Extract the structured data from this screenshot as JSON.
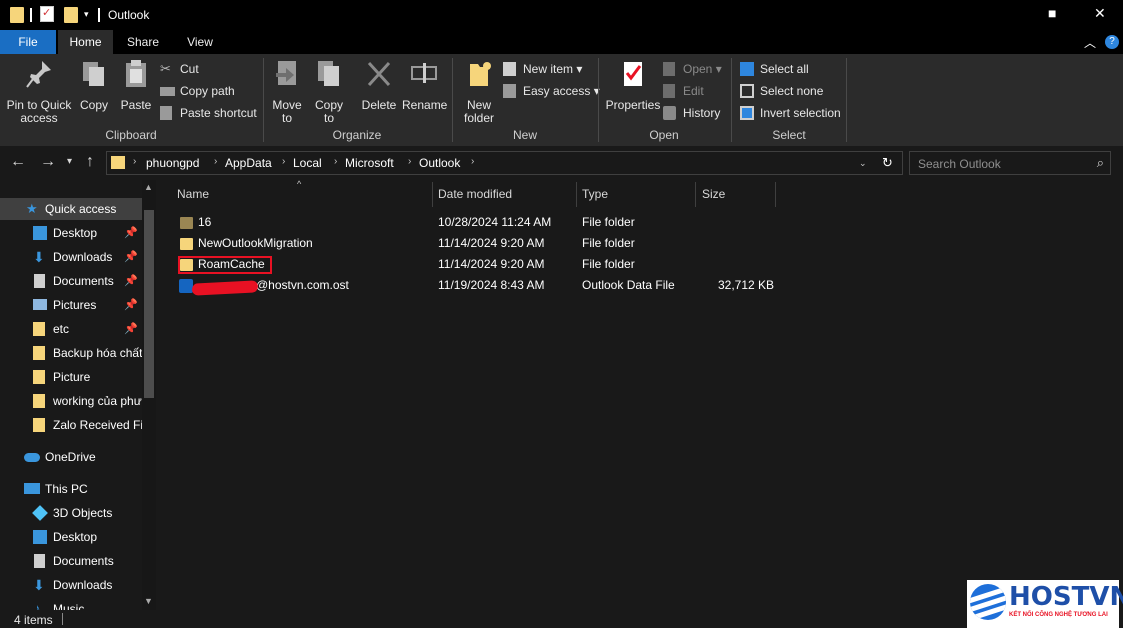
{
  "window": {
    "title": "Outlook",
    "buttons": {
      "minimize": "■",
      "close": "✕"
    }
  },
  "tabs": {
    "file": "File",
    "home": "Home",
    "share": "Share",
    "view": "View"
  },
  "ribbon": {
    "clipboard": {
      "label": "Clipboard",
      "pin": "Pin to Quick access",
      "copy": "Copy",
      "paste": "Paste",
      "cut": "Cut",
      "copy_path": "Copy path",
      "paste_shortcut": "Paste shortcut"
    },
    "organize": {
      "label": "Organize",
      "move_to": "Move to",
      "copy_to": "Copy to",
      "delete": "Delete",
      "rename": "Rename"
    },
    "new": {
      "label": "New",
      "new_folder": "New folder",
      "new_item": "New item",
      "easy_access": "Easy access"
    },
    "open": {
      "label": "Open",
      "properties": "Properties",
      "open": "Open",
      "edit": "Edit",
      "history": "History"
    },
    "select": {
      "label": "Select",
      "select_all": "Select all",
      "select_none": "Select none",
      "invert_selection": "Invert selection"
    }
  },
  "address": {
    "crumbs": [
      "phuongpd",
      "AppData",
      "Local",
      "Microsoft",
      "Outlook"
    ],
    "search_placeholder": "Search Outlook"
  },
  "nav": {
    "quick_access": "Quick access",
    "items": [
      {
        "label": "Desktop",
        "icon": "desktop-icon",
        "pinned": true
      },
      {
        "label": "Downloads",
        "icon": "downloads-icon",
        "pinned": true
      },
      {
        "label": "Documents",
        "icon": "documents-icon",
        "pinned": true
      },
      {
        "label": "Pictures",
        "icon": "pictures-icon",
        "pinned": true
      },
      {
        "label": "etc",
        "icon": "folder-icon",
        "pinned": true
      },
      {
        "label": "Backup hóa chất",
        "icon": "folder-icon",
        "pinned": false
      },
      {
        "label": "Picture",
        "icon": "folder-icon",
        "pinned": false
      },
      {
        "label": "working của phư",
        "icon": "folder-icon",
        "pinned": false
      },
      {
        "label": "Zalo Received Fi",
        "icon": "folder-icon",
        "pinned": false
      }
    ],
    "onedrive": "OneDrive",
    "this_pc": "This PC",
    "pc_items": [
      {
        "label": "3D Objects",
        "icon": "3d-objects-icon"
      },
      {
        "label": "Desktop",
        "icon": "desktop-icon"
      },
      {
        "label": "Documents",
        "icon": "documents-icon"
      },
      {
        "label": "Downloads",
        "icon": "downloads-icon"
      },
      {
        "label": "Music",
        "icon": "music-icon"
      }
    ]
  },
  "columns": {
    "name": "Name",
    "date": "Date modified",
    "type": "Type",
    "size": "Size"
  },
  "files": [
    {
      "name": "16",
      "date": "10/28/2024 11:24 AM",
      "type": "File folder",
      "size": "",
      "icon": "folder-icon"
    },
    {
      "name": "NewOutlookMigration",
      "date": "11/14/2024 9:20 AM",
      "type": "File folder",
      "size": "",
      "icon": "folder-icon"
    },
    {
      "name": "RoamCache",
      "date": "11/14/2024 9:20 AM",
      "type": "File folder",
      "size": "",
      "icon": "folder-icon"
    },
    {
      "name": "@hostvn.com.ost",
      "date": "11/19/2024 8:43 AM",
      "type": "Outlook Data File",
      "size": "32,712 KB",
      "icon": "outlook-data-file-icon"
    }
  ],
  "status": {
    "count": "4 items"
  },
  "watermark": {
    "brand": "HOSTVN",
    "tagline": "KẾT NỐI CÔNG NGHỆ TƯƠNG LAI"
  },
  "colors": {
    "accent": "#1a6ec3",
    "folder": "#f6d57b",
    "highlight": "#e81123"
  }
}
